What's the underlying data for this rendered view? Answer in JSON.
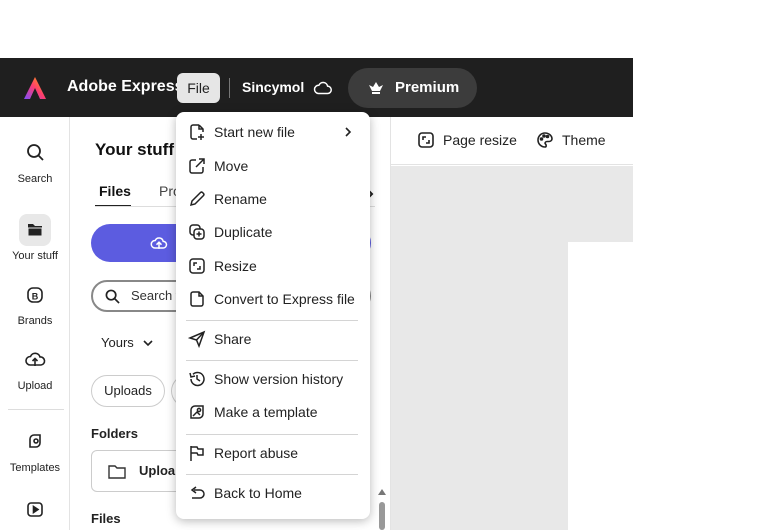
{
  "topbar": {
    "app_name": "Adobe Express",
    "file_label": "File",
    "document_name": "Sincymol",
    "premium_label": "Premium"
  },
  "rail": {
    "items": [
      {
        "label": "Search",
        "icon": "search-icon"
      },
      {
        "label": "Your stuff",
        "icon": "folder-icon",
        "active": true
      },
      {
        "label": "Brands",
        "icon": "brand-icon"
      },
      {
        "label": "Upload",
        "icon": "upload-icon"
      },
      {
        "label": "Templates",
        "icon": "templates-icon"
      }
    ]
  },
  "panel": {
    "title": "Your stuff",
    "tabs": [
      "Files",
      "Pro"
    ],
    "search_placeholder": "Search f",
    "filter_label": "Yours",
    "chip_label": "Uploads",
    "folders_heading": "Folders",
    "folder_name": "Uploa",
    "files_heading": "Files"
  },
  "toolbar": {
    "page_resize": "Page resize",
    "theme": "Theme"
  },
  "file_menu": {
    "items": [
      {
        "label": "Start new file",
        "icon": "new-file-icon",
        "submenu": true
      },
      {
        "label": "Move",
        "icon": "move-icon"
      },
      {
        "label": "Rename",
        "icon": "pencil-icon"
      },
      {
        "label": "Duplicate",
        "icon": "duplicate-icon"
      },
      {
        "label": "Resize",
        "icon": "resize-icon"
      },
      {
        "label": "Convert to Express file",
        "icon": "convert-file-icon"
      },
      {
        "label": "Share",
        "icon": "share-icon"
      },
      {
        "label": "Show version history",
        "icon": "history-icon"
      },
      {
        "label": "Make a template",
        "icon": "template-icon"
      },
      {
        "label": "Report abuse",
        "icon": "flag-icon"
      },
      {
        "label": "Back to Home",
        "icon": "back-icon"
      }
    ]
  },
  "colors": {
    "topbar_bg": "#1f1f1f",
    "accent": "#5c5ce0",
    "canvas_bg": "#e8e8e8"
  }
}
